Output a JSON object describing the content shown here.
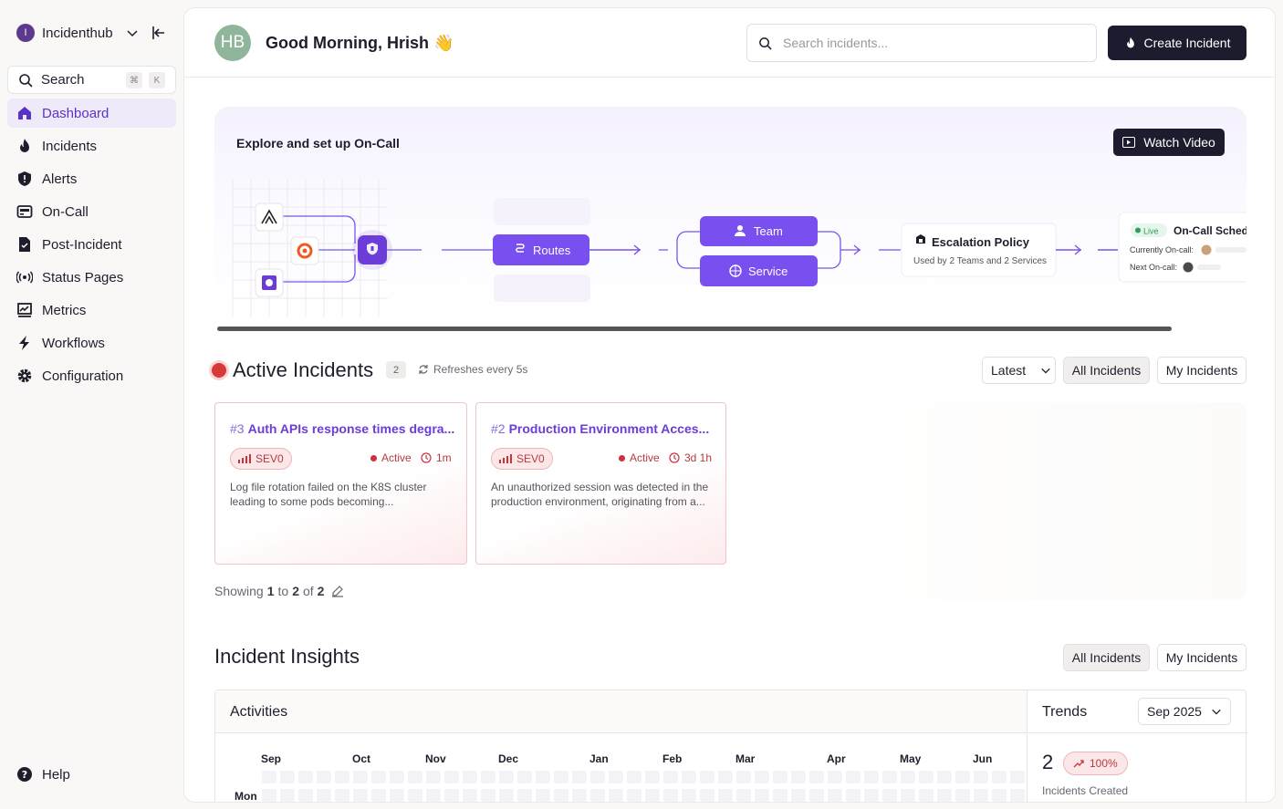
{
  "sidebar": {
    "org_initial": "I",
    "org_name": "Incidenthub",
    "search_label": "Search",
    "shortcut": [
      "⌘",
      "K"
    ],
    "items": [
      {
        "label": "Dashboard",
        "icon": "home-icon",
        "active": true
      },
      {
        "label": "Incidents",
        "icon": "flame-icon"
      },
      {
        "label": "Alerts",
        "icon": "shield-alert-icon"
      },
      {
        "label": "On-Call",
        "icon": "pager-icon"
      },
      {
        "label": "Post-Incident",
        "icon": "document-icon"
      },
      {
        "label": "Status Pages",
        "icon": "broadcast-icon"
      },
      {
        "label": "Metrics",
        "icon": "chart-icon"
      },
      {
        "label": "Workflows",
        "icon": "bolt-icon"
      },
      {
        "label": "Configuration",
        "icon": "gear-icon"
      }
    ],
    "help_label": "Help"
  },
  "header": {
    "avatar_initials": "HB",
    "greeting": "Good Morning, Hrish 👋",
    "search_placeholder": "Search incidents...",
    "create_label": "Create Incident"
  },
  "banner": {
    "title": "Explore and set up On-Call",
    "watch_label": "Watch Video",
    "routes_label": "Routes",
    "team_label": "Team",
    "service_label": "Service",
    "escalation_title": "Escalation Policy",
    "escalation_sub": "Used by 2 Teams and 2 Services",
    "live_label": "Live",
    "schedule_title": "On-Call Sched",
    "currently_label": "Currently On-call:",
    "next_label": "Next On-call:"
  },
  "active_incidents": {
    "title": "Active Incidents",
    "count": "2",
    "refresh_label": "Refreshes every 5s",
    "sort_label": "Latest",
    "filter_all": "All Incidents",
    "filter_mine": "My Incidents",
    "cards": [
      {
        "num": "#3",
        "title": "Auth APIs response times degra...",
        "severity": "SEV0",
        "status": "Active",
        "age": "1m",
        "description": "Log file rotation failed on the K8S cluster leading to some pods becoming..."
      },
      {
        "num": "#2",
        "title": "Production Environment Acces...",
        "severity": "SEV0",
        "status": "Active",
        "age": "3d 1h",
        "description": "An unauthorized session was detected in the production environment, originating from a..."
      }
    ],
    "showing": {
      "prefix": "Showing",
      "from": "1",
      "to_word": "to",
      "to": "2",
      "of_word": "of",
      "total": "2"
    }
  },
  "insights": {
    "title": "Incident Insights",
    "filter_all": "All Incidents",
    "filter_mine": "My Incidents",
    "activities_label": "Activities",
    "trends_label": "Trends",
    "month_selected": "Sep 2025",
    "months": [
      "Sep",
      "Oct",
      "Nov",
      "Dec",
      "Jan",
      "Feb",
      "Mar",
      "Apr",
      "May",
      "Jun"
    ],
    "day_label": "Mon",
    "trend_value": "2",
    "trend_change": "100%",
    "trend_caption": "Incidents Created"
  }
}
